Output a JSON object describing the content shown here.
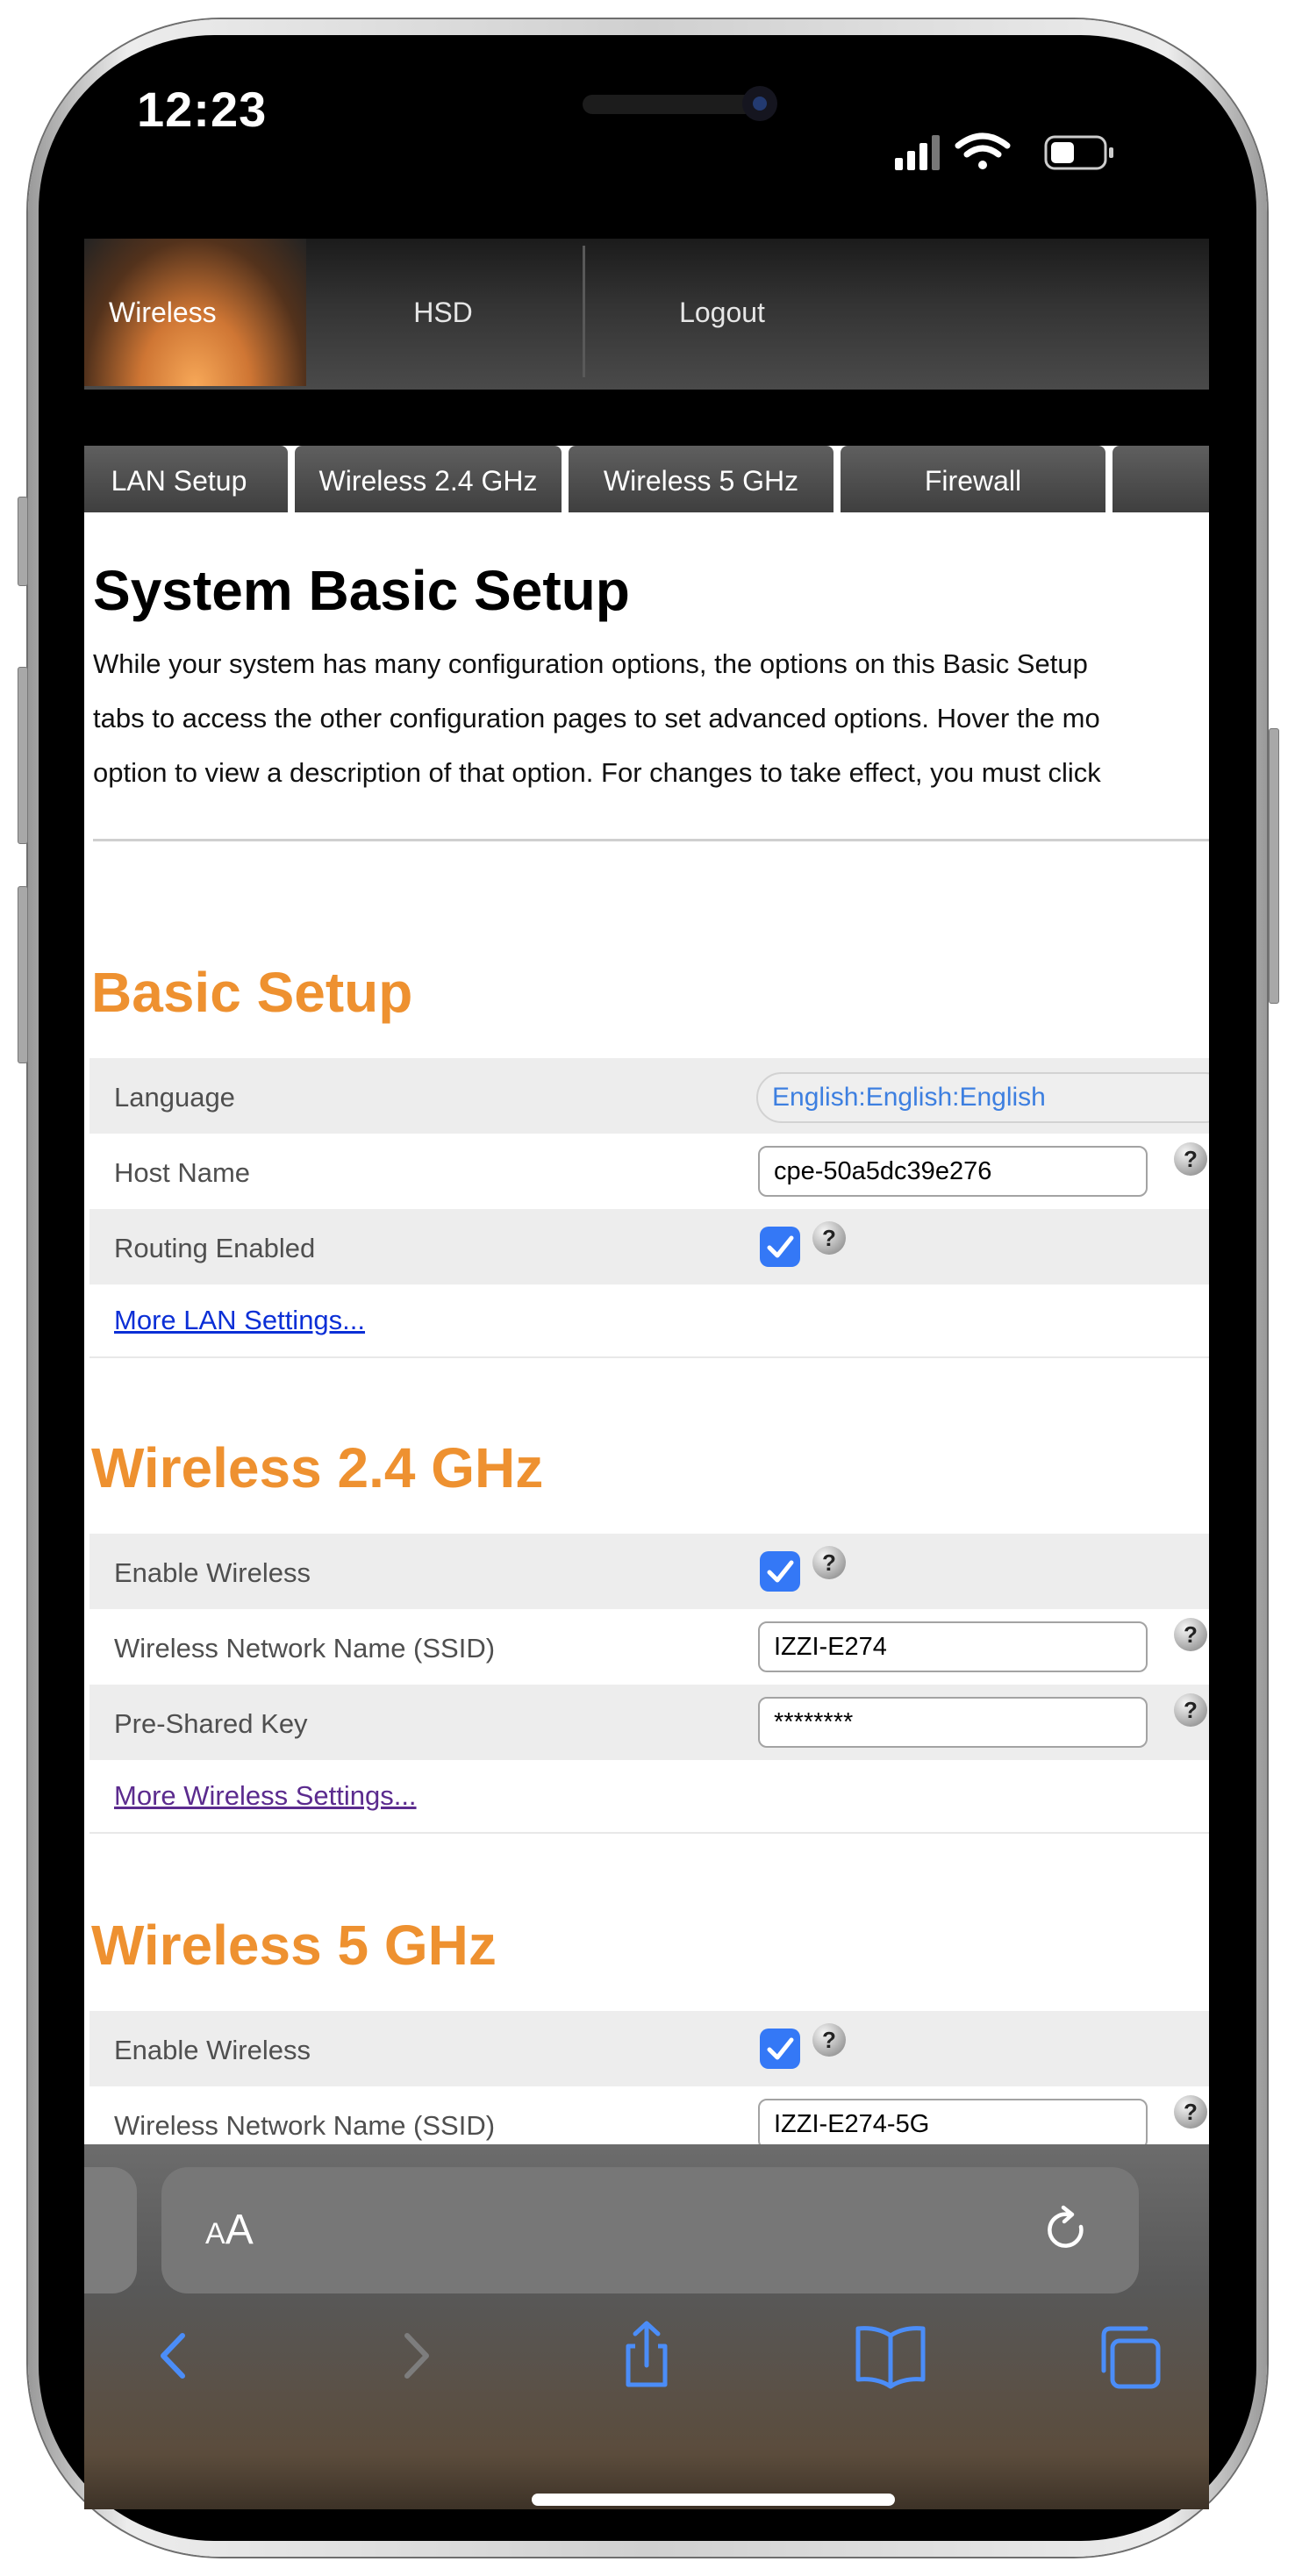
{
  "status_bar": {
    "time": "12:23"
  },
  "router_nav": {
    "tabs": [
      {
        "label": "Wireless"
      },
      {
        "label": "HSD"
      },
      {
        "label": "Logout"
      }
    ]
  },
  "sub_tabs": [
    "LAN Setup",
    "Wireless 2.4 GHz",
    "Wireless 5 GHz",
    "Firewall"
  ],
  "page": {
    "title": "System Basic Setup",
    "intro_lines": [
      "While your system has many configuration options, the options on this Basic Setup",
      "tabs to access the other configuration pages to set advanced options. Hover the mo",
      "option to view a description of that option. For changes to take effect, you must click"
    ]
  },
  "basic_setup": {
    "title": "Basic Setup",
    "language_label": "Language",
    "language_value": "English:English:English",
    "host_name_label": "Host Name",
    "host_name_value": "cpe-50a5dc39e276",
    "routing_label": "Routing Enabled",
    "routing_enabled": true,
    "more_link": "More LAN Settings..."
  },
  "wireless_24": {
    "title": "Wireless 2.4 GHz",
    "enable_label": "Enable Wireless",
    "enabled": true,
    "ssid_label": "Wireless Network Name (SSID)",
    "ssid_value": "IZZI-E274",
    "psk_label": "Pre-Shared Key",
    "psk_value": "********",
    "more_link": "More Wireless Settings..."
  },
  "wireless_5": {
    "title": "Wireless 5 GHz",
    "enable_label": "Enable Wireless",
    "enabled": true,
    "ssid_label": "Wireless Network Name (SSID)",
    "ssid_value": "IZZI-E274-5G"
  },
  "help_glyph": "?",
  "safari": {
    "aa_small": "A",
    "aa_large": "A"
  },
  "colors": {
    "section_title": "#ee9130",
    "link": "#0b2fd6",
    "link_visited": "#5b2b8e",
    "checkbox": "#3478f6",
    "toolbar_icon": "#4b8df8"
  }
}
